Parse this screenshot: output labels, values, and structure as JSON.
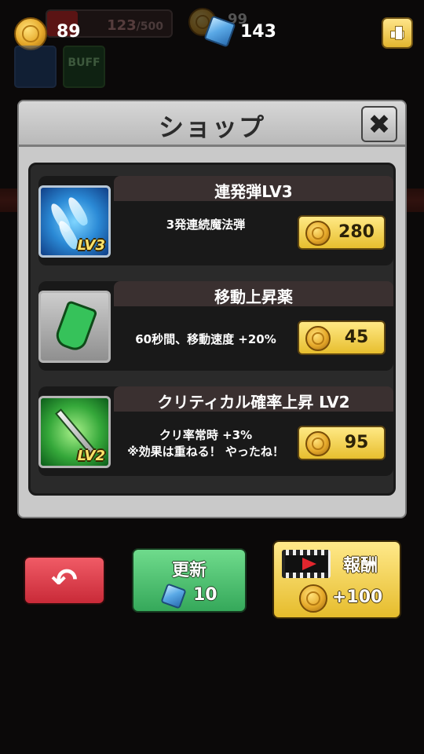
{
  "hud": {
    "coins": "89",
    "gems": "143",
    "hp_text": "123",
    "hp_max": "/500",
    "hp_fraction": 0.246,
    "dim_number": "99",
    "buff_label": "BUFF"
  },
  "shop": {
    "title": "ショップ",
    "close_symbol": "✖",
    "items": [
      {
        "title": "連発弾LV3",
        "desc_line1": "3発連続魔法弾",
        "desc_line2": "",
        "level_badge": "LV3",
        "price": "280",
        "icon": "multishot-icon"
      },
      {
        "title": "移動上昇薬",
        "desc_line1": "60秒間、移動速度 +20%",
        "desc_line2": "",
        "level_badge": "",
        "price": "45",
        "icon": "potion-icon"
      },
      {
        "title": "クリティカル確率上昇 LV2",
        "desc_line1": "クリ率常時 +3%",
        "desc_line2": "※効果は重ねる！ やったね！",
        "level_badge": "LV2",
        "price": "95",
        "icon": "sword-icon"
      }
    ]
  },
  "buttons": {
    "back_symbol": "↶",
    "refresh_label": "更新",
    "refresh_cost": "10",
    "reward_label": "報酬",
    "reward_amount": "+100"
  },
  "colors": {
    "coin": "#e6a92a",
    "gem": "#5aa9e6",
    "back": "#d63a46",
    "refresh": "#4cc06e",
    "reward": "#f2cf4f"
  }
}
